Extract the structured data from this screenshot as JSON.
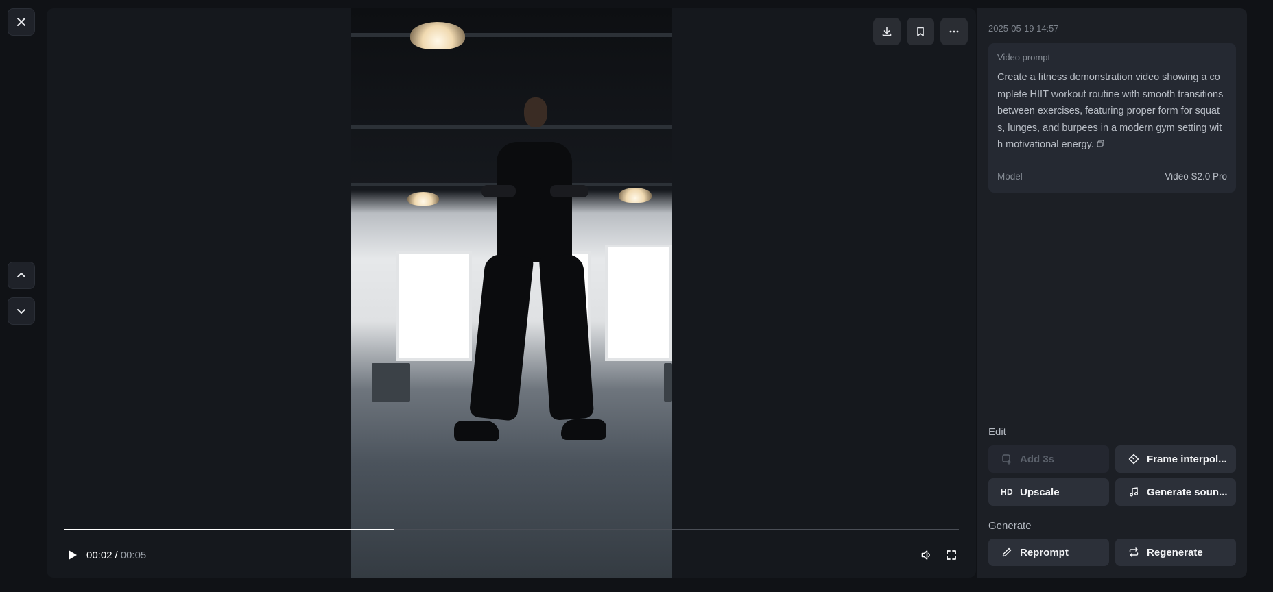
{
  "nav": {
    "close_icon": "close-icon",
    "up_icon": "chevron-up-icon",
    "down_icon": "chevron-down-icon"
  },
  "video": {
    "description_icon": "video-frame",
    "progress_fraction": 0.368,
    "current_time": "00:02",
    "separator": "/",
    "total_time": "00:05",
    "top_actions": [
      "download-icon",
      "bookmark-icon",
      "more-icon"
    ],
    "controls": [
      "play-icon",
      "volume-icon",
      "fullscreen-icon"
    ]
  },
  "sidebar": {
    "timestamp": "2025-05-19 14:57",
    "prompt_label": "Video prompt",
    "prompt_text": "Create a fitness demonstration video showing a complete HIIT workout routine with smooth transitions between exercises, featuring proper form for squats, lunges, and burpees in a modern gym setting with motivational energy.",
    "model_label": "Model",
    "model_value": "Video S2.0 Pro",
    "edit_label": "Edit",
    "edit_buttons": {
      "add3s": "Add 3s",
      "frame": "Frame interpol...",
      "upscale_badge": "HD",
      "upscale": "Upscale",
      "sound": "Generate soun..."
    },
    "generate_label": "Generate",
    "generate_buttons": {
      "reprompt": "Reprompt",
      "regenerate": "Regenerate"
    }
  },
  "colors": {
    "background": "#101216",
    "panel": "#1c1f25",
    "card": "#252932",
    "button": "#2c3039",
    "accent_white": "#ffffff"
  }
}
